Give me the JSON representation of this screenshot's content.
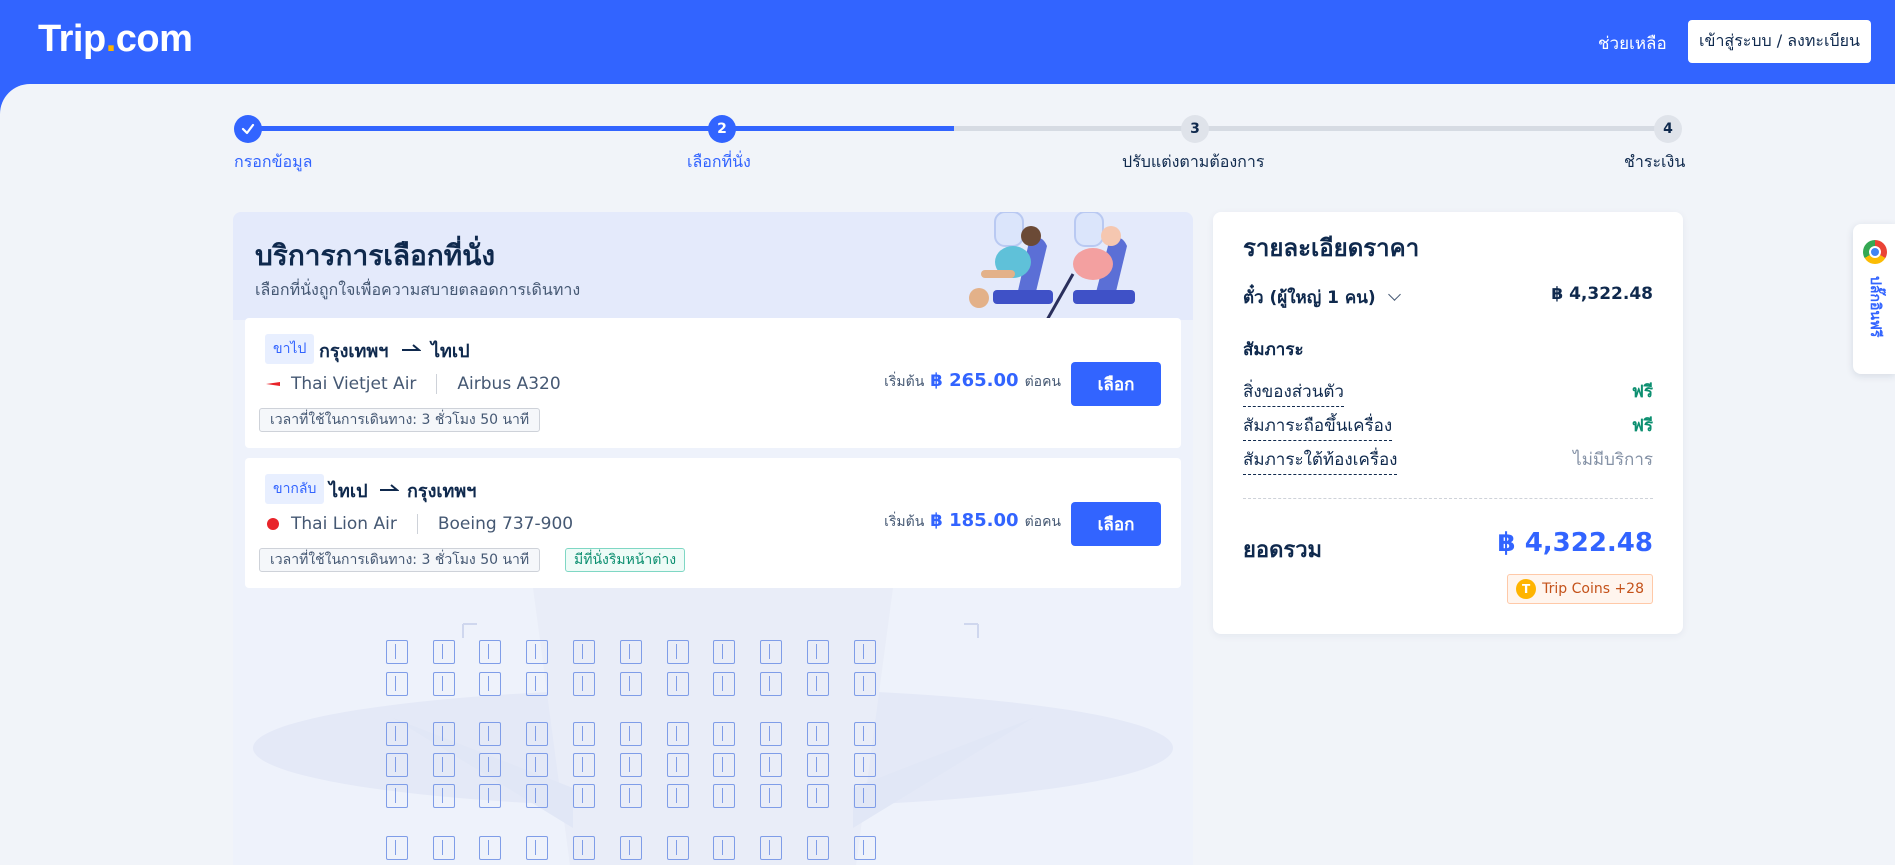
{
  "header": {
    "logo_text": "Trip",
    "logo_dot": ".",
    "logo_suffix": "com",
    "help": "ช่วยเหลือ",
    "login": "เข้าสู่ระบบ / ลงทะเบียน"
  },
  "steps": [
    {
      "num": "",
      "label": "กรอกข้อมูล",
      "state": "done"
    },
    {
      "num": "2",
      "label": "เลือกที่นั่ง",
      "state": "active"
    },
    {
      "num": "3",
      "label": "ปรับแต่งตามต้องการ",
      "state": "todo"
    },
    {
      "num": "4",
      "label": "ชำระเงิน",
      "state": "todo"
    }
  ],
  "seat_panel": {
    "title": "บริการการเลือกที่นั่ง",
    "subtitle": "เลือกที่นั่งถูกใจเพื่อความสบายตลอดการเดินทาง"
  },
  "flights": [
    {
      "direction": "ขาไป",
      "from": "กรุงเทพฯ",
      "to": "ไทเป",
      "airline": "Thai Vietjet Air",
      "aircraft": "Airbus A320",
      "duration": "เวลาที่ใช้ในการเดินทาง: 3 ชั่วโมง 50 นาที",
      "price_prefix": "เริ่มต้น",
      "price": "฿ 265.00",
      "price_suffix": "ต่อคน",
      "select": "เลือก"
    },
    {
      "direction": "ขากลับ",
      "from": "ไทเป",
      "to": "กรุงเทพฯ",
      "airline": "Thai Lion Air",
      "aircraft": "Boeing 737-900",
      "duration": "เวลาที่ใช้ในการเดินทาง: 3 ชั่วโมง 50 นาที",
      "window_tag": "มีที่นั่งริมหน้าต่าง",
      "price_prefix": "เริ่มต้น",
      "price": "฿ 185.00",
      "price_suffix": "ต่อคน",
      "select": "เลือก"
    }
  ],
  "price_detail": {
    "title": "รายละเอียดราคา",
    "ticket_label": "ตั๋ว (ผู้ใหญ่ 1 คน)",
    "ticket_value": "฿ 4,322.48",
    "baggage_title": "สัมภาระ",
    "baggage": [
      {
        "name": "สิ่งของส่วนตัว",
        "value": "ฟรี",
        "kind": "free"
      },
      {
        "name": "สัมภาระถือขึ้นเครื่อง",
        "value": "ฟรี",
        "kind": "free"
      },
      {
        "name": "สัมภาระใต้ท้องเครื่อง",
        "value": "ไม่มีบริการ",
        "kind": "none"
      }
    ],
    "total_label": "ยอดรวม",
    "total_value": "฿ 4,322.48",
    "coins": "Trip Coins +28",
    "coin_symbol": "T"
  },
  "side_tab": {
    "label": "ปลั๊กอินฟรี"
  },
  "colors": {
    "brand": "#3264ff",
    "free": "#0c8f70",
    "coin": "#ffb400"
  }
}
